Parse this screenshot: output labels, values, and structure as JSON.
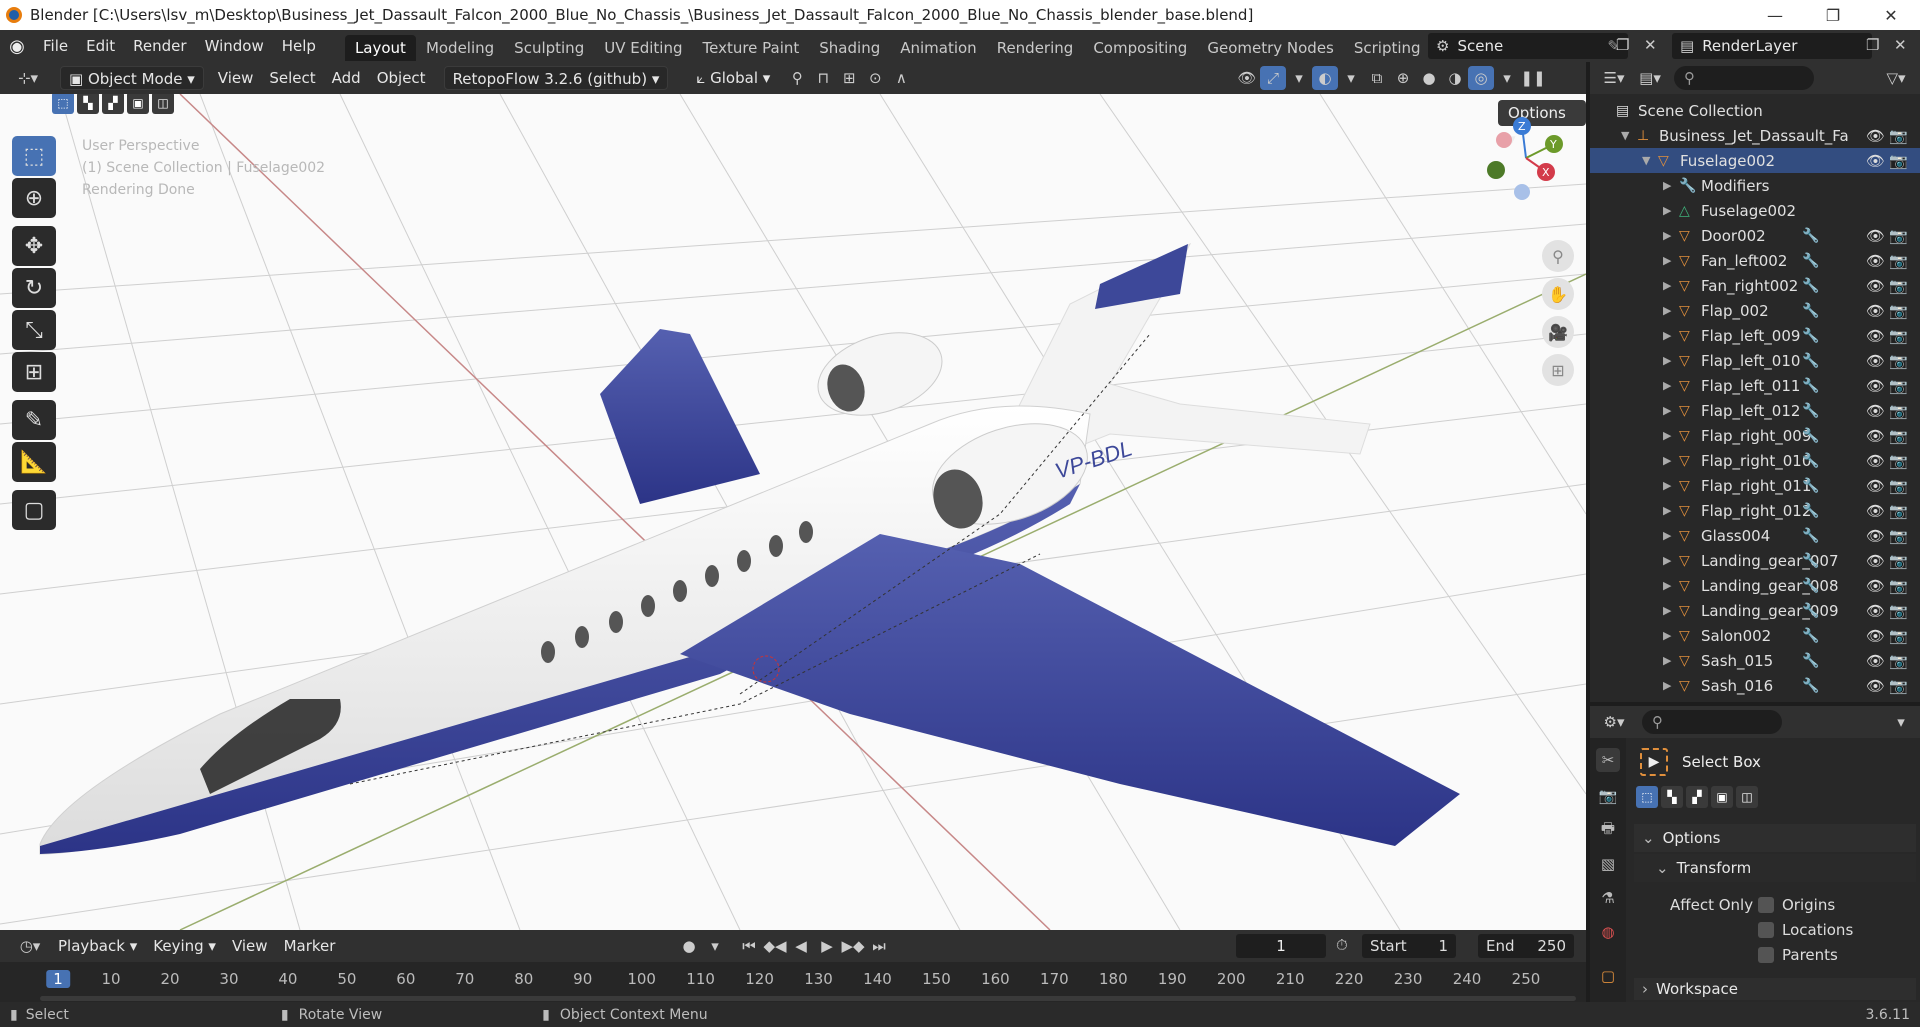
{
  "window": {
    "title": "Blender [C:\\Users\\lsv_m\\Desktop\\Business_Jet_Dassault_Falcon_2000_Blue_No_Chassis_\\Business_Jet_Dassault_Falcon_2000_Blue_No_Chassis_blender_base.blend]",
    "minimize": "—",
    "maximize": "❐",
    "close": "✕"
  },
  "menu": {
    "file": "File",
    "edit": "Edit",
    "render": "Render",
    "window": "Window",
    "help": "Help"
  },
  "workspaces": [
    "Layout",
    "Modeling",
    "Sculpting",
    "UV Editing",
    "Texture Paint",
    "Shading",
    "Animation",
    "Rendering",
    "Compositing",
    "Geometry Nodes",
    "Scripting"
  ],
  "add_workspace": "+",
  "scene": {
    "name": "Scene",
    "render_layer": "RenderLayer"
  },
  "viewport_header": {
    "mode": "Object Mode",
    "view": "View",
    "select": "Select",
    "add": "Add",
    "object": "Object",
    "addon": "RetopoFlow 3.2.6 (github)",
    "orientation": "Global",
    "options": "Options"
  },
  "viewport_overlay": {
    "perspective": "User Perspective",
    "collection": "(1) Scene Collection | Fuselage002",
    "status": "Rendering Done"
  },
  "aircraft": {
    "registration": "VP-BDL"
  },
  "gizmo": {
    "z": "Z",
    "y": "Y",
    "x": "X"
  },
  "outliner": {
    "root": "Scene Collection",
    "collection": "Business_Jet_Dassault_Fa",
    "object": "Fuselage002",
    "children": [
      "Modifiers",
      "Fuselage002"
    ],
    "items": [
      "Door002",
      "Fan_left002",
      "Fan_right002",
      "Flap_002",
      "Flap_left_009",
      "Flap_left_010",
      "Flap_left_011",
      "Flap_left_012",
      "Flap_right_009",
      "Flap_right_010",
      "Flap_right_011",
      "Flap_right_012",
      "Glass004",
      "Landing_gear_007",
      "Landing_gear_008",
      "Landing_gear_009",
      "Salon002",
      "Sash_015",
      "Sash_016"
    ]
  },
  "properties": {
    "tool": "Select Box",
    "options": "Options",
    "transform": "Transform",
    "affect_only": "Affect Only",
    "origins": "Origins",
    "locations": "Locations",
    "parents": "Parents",
    "workspace": "Workspace"
  },
  "timeline": {
    "playback": "Playback",
    "keying": "Keying",
    "view": "View",
    "marker": "Marker",
    "current_frame": "1",
    "start_label": "Start",
    "start": "1",
    "end_label": "End",
    "end": "250",
    "ticks": [
      "1",
      "10",
      "20",
      "30",
      "40",
      "50",
      "60",
      "70",
      "80",
      "90",
      "100",
      "110",
      "120",
      "130",
      "140",
      "150",
      "160",
      "170",
      "180",
      "190",
      "200",
      "210",
      "220",
      "230",
      "240",
      "250"
    ]
  },
  "status": {
    "select": "Select",
    "rotate": "Rotate View",
    "context": "Object Context Menu",
    "version": "3.6.11"
  }
}
